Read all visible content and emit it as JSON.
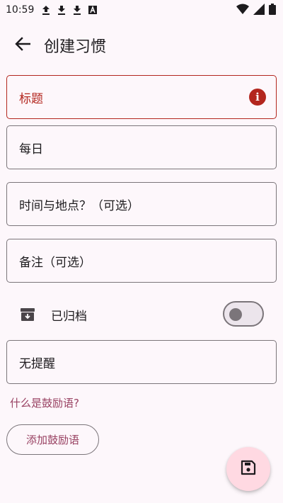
{
  "status_bar": {
    "time": "10:59",
    "left_icons": [
      "upload-icon",
      "download-icon",
      "download-icon",
      "a-box-icon"
    ],
    "right_icons": [
      "wifi-icon",
      "signal-icon",
      "battery-icon"
    ]
  },
  "app_bar": {
    "back_icon": "arrow-back-icon",
    "title": "创建习惯"
  },
  "fields": {
    "title": {
      "placeholder": "标题",
      "state": "error",
      "icon": "error-icon",
      "error_glyph": "i"
    },
    "frequency": {
      "value": "每日"
    },
    "time_place": {
      "placeholder": "时间与地点？（可选）"
    },
    "notes": {
      "placeholder": "备注（可选）"
    },
    "reminder": {
      "value": "无提醒"
    }
  },
  "archive": {
    "icon": "archive-icon",
    "label": "已归档",
    "checked": false
  },
  "encouragement": {
    "link": "什么是鼓励语?",
    "button": "添加鼓励语"
  },
  "fab": {
    "icon": "save-icon"
  },
  "colors": {
    "background": "#fdf7fb",
    "error": "#b3261e",
    "accent": "#984061",
    "fab": "#ffd9e2",
    "outline": "#7b757a"
  }
}
